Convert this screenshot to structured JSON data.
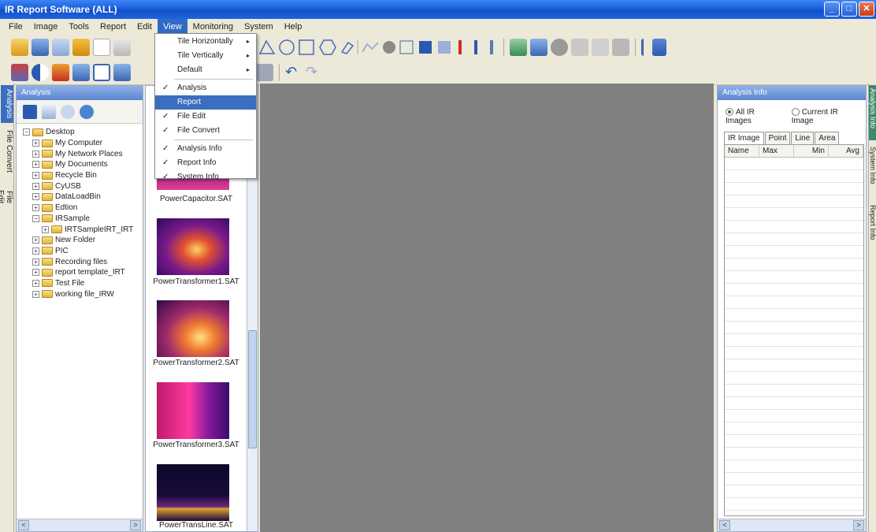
{
  "app": {
    "title": "IR Report Software (ALL)"
  },
  "menu": {
    "items": [
      "File",
      "Image",
      "Tools",
      "Report",
      "Edit",
      "View",
      "Monitoring",
      "System",
      "Help"
    ],
    "active": "View"
  },
  "view_menu": {
    "tile_horizontally": "Tile Horizontally",
    "tile_vertically": "Tile Vertically",
    "default": "Default",
    "analysis": "Analysis",
    "report": "Report",
    "file_edit": "File Edit",
    "file_convert": "File Convert",
    "analysis_info": "Analysis Info",
    "report_info": "Report Info",
    "system_info": "System Info",
    "check": "✓",
    "submenu_arrow": "▸"
  },
  "left_tabs": {
    "analysis": "Analysis",
    "file_convert": "File Convert",
    "file_edit": "File Edit"
  },
  "analysis_panel": {
    "title": "Analysis",
    "tree": [
      {
        "label": "Desktop",
        "level": 0,
        "expander": "−"
      },
      {
        "label": "My Computer",
        "level": 1,
        "expander": "+"
      },
      {
        "label": "My Network Places",
        "level": 1,
        "expander": "+"
      },
      {
        "label": "My Documents",
        "level": 1,
        "expander": "+"
      },
      {
        "label": "Recycle Bin",
        "level": 1,
        "expander": "+"
      },
      {
        "label": "CyUSB",
        "level": 1,
        "expander": "+"
      },
      {
        "label": "DataLoadBin",
        "level": 1,
        "expander": "+"
      },
      {
        "label": "Edtion",
        "level": 1,
        "expander": "+"
      },
      {
        "label": "IRSample",
        "level": 1,
        "expander": "−"
      },
      {
        "label": "IRTSampleIRT_IRT",
        "level": 2,
        "expander": "+"
      },
      {
        "label": "New Folder",
        "level": 1,
        "expander": "+"
      },
      {
        "label": "PIC",
        "level": 1,
        "expander": "+"
      },
      {
        "label": "Recording files",
        "level": 1,
        "expander": "+"
      },
      {
        "label": "report template_IRT",
        "level": 1,
        "expander": "+"
      },
      {
        "label": "Test File",
        "level": 1,
        "expander": "+"
      },
      {
        "label": "working file_IRW",
        "level": 1,
        "expander": "+"
      }
    ],
    "scroll_left": "<",
    "scroll_right": ">"
  },
  "thumbnails": [
    {
      "caption": "PowerCapacitor.SAT"
    },
    {
      "caption": "PowerTransformer1.SAT"
    },
    {
      "caption": "PowerTransformer2.SAT"
    },
    {
      "caption": "PowerTransformer3.SAT"
    },
    {
      "caption": "PowerTransLine.SAT"
    }
  ],
  "info_panel": {
    "title": "Analysis Info",
    "radio_all": "All IR Images",
    "radio_current": "Current IR Image",
    "tabs": [
      "IR Image",
      "Point",
      "Line",
      "Area"
    ],
    "columns": [
      "Name",
      "Max",
      "Min",
      "Avg"
    ],
    "scroll_left": "<",
    "scroll_right": ">"
  },
  "right_tabs": {
    "analysis_info": "Analysis Info",
    "system_info": "System Info",
    "report_info": "Report Info"
  },
  "window_buttons": {
    "minimize": "_",
    "maximize": "□",
    "close": "✕"
  },
  "colors": {
    "accent": "#316ac5",
    "canvas": "#808080",
    "title_blue": "#1a5fd8"
  }
}
